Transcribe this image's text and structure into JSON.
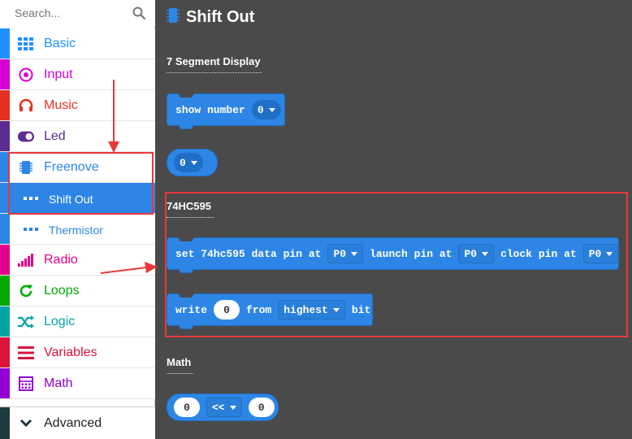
{
  "search": {
    "placeholder": "Search..."
  },
  "categories": [
    {
      "label": "Basic",
      "color": "#1e90ff",
      "icon": "grid-icon"
    },
    {
      "label": "Input",
      "color": "#d400d4",
      "icon": "target-icon"
    },
    {
      "label": "Music",
      "color": "#e63022",
      "icon": "headphones-icon"
    },
    {
      "label": "Led",
      "color": "#5c2d91",
      "icon": "toggle-icon"
    },
    {
      "label": "Freenove",
      "color": "#2d86e6",
      "icon": "chip-icon"
    },
    {
      "label": "Shift Out",
      "color": "#2d86e6",
      "icon": "dots-icon"
    },
    {
      "label": "Thermistor",
      "color": "#2d86e6",
      "icon": "dots-icon"
    },
    {
      "label": "Radio",
      "color": "#e3008c",
      "icon": "signal-icon"
    },
    {
      "label": "Loops",
      "color": "#00aa00",
      "icon": "refresh-icon"
    },
    {
      "label": "Logic",
      "color": "#00a4a6",
      "icon": "shuffle-icon"
    },
    {
      "label": "Variables",
      "color": "#dc143c",
      "icon": "lines-icon"
    },
    {
      "label": "Math",
      "color": "#9400d3",
      "icon": "calculator-icon"
    }
  ],
  "advanced": {
    "label": "Advanced"
  },
  "flyout": {
    "title": "Shift Out",
    "sections": {
      "seven_segment": "7 Segment Display",
      "hc595": "74HC595",
      "math": "Math"
    },
    "show_number": {
      "text": "show number",
      "value": "0"
    },
    "zero_reporter": {
      "value": "0"
    },
    "set_block": {
      "t1": "set 74hc595 data pin at",
      "p1": "P0",
      "t2": "launch pin at",
      "p2": "P0",
      "t3": "clock pin at",
      "p3": "P0"
    },
    "write_block": {
      "t1": "write",
      "value": "0",
      "t2": "from",
      "order": "highest",
      "t3": "bit"
    },
    "shift_reporter": {
      "left": "0",
      "op": "<<",
      "right": "0"
    }
  },
  "colors": {
    "workspace": "#4b4a4a",
    "block": "#2d86e6",
    "highlight": "#e8383d"
  }
}
